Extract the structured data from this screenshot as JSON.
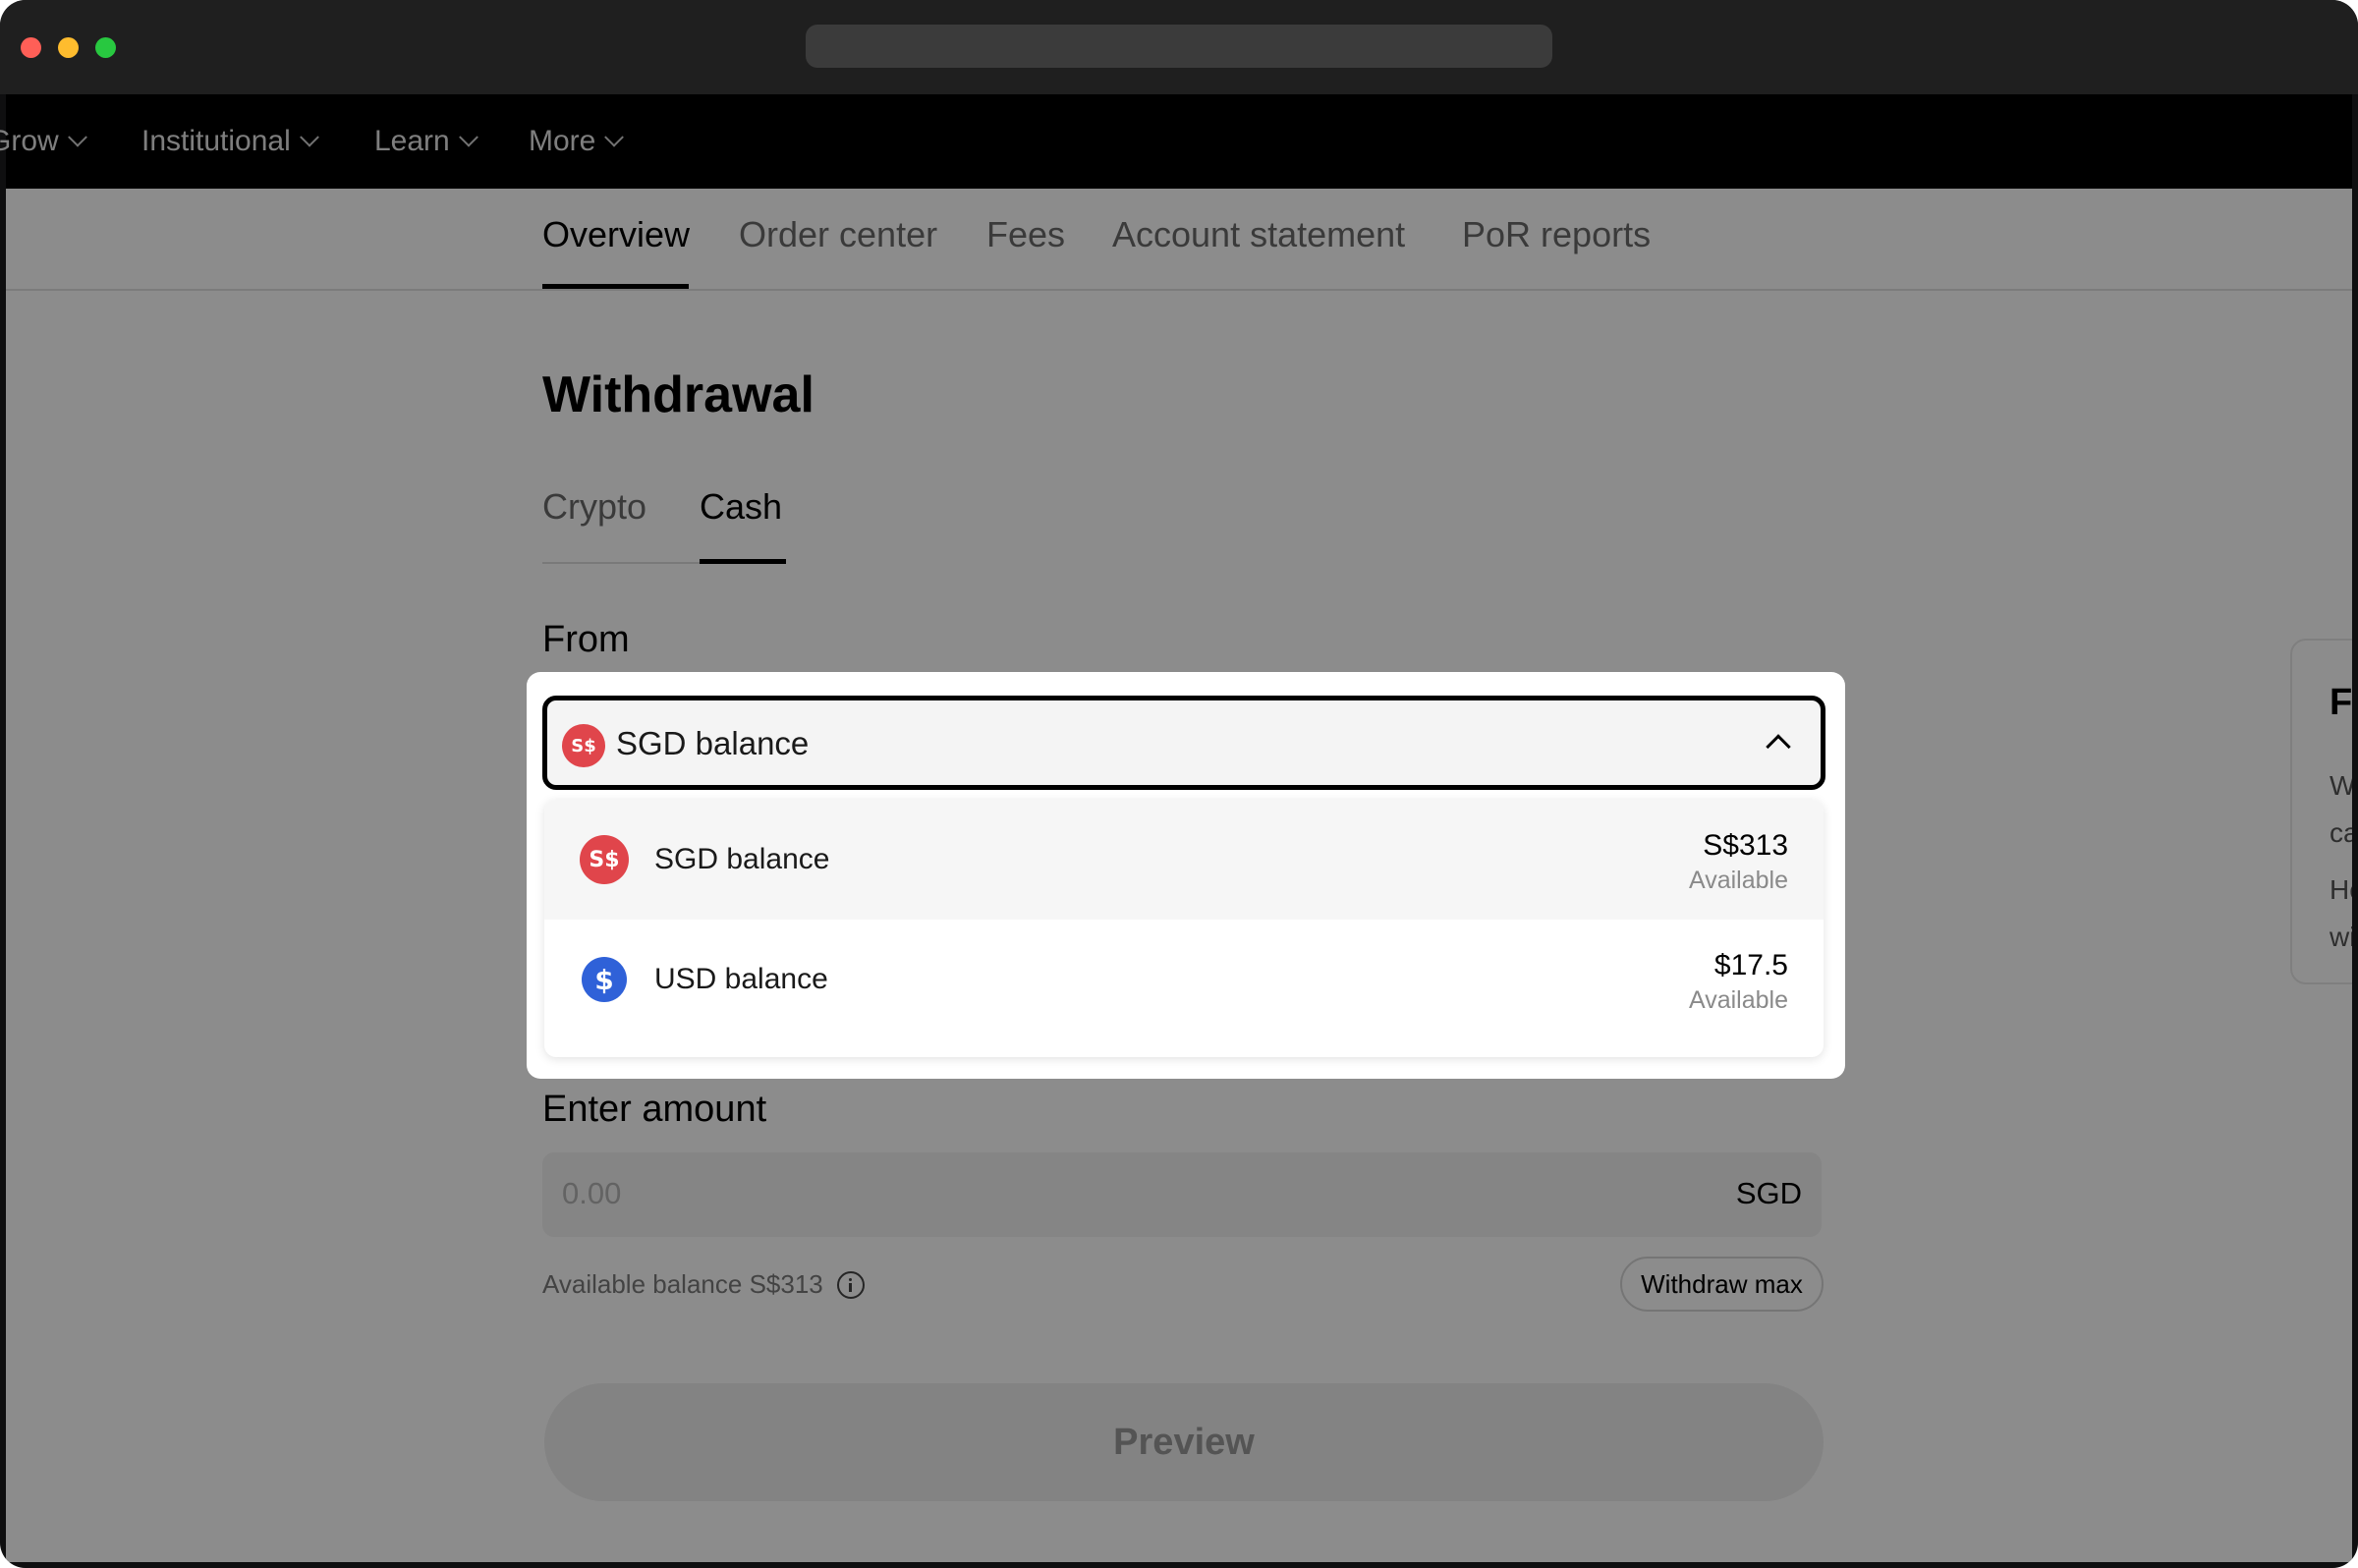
{
  "window": {
    "traffic_lights": [
      "close",
      "minimize",
      "zoom"
    ]
  },
  "topnav": {
    "items": [
      {
        "label": "Grow"
      },
      {
        "label": "Institutional"
      },
      {
        "label": "Learn"
      },
      {
        "label": "More"
      }
    ]
  },
  "subnav": {
    "tabs": [
      {
        "label": "Overview",
        "active": true
      },
      {
        "label": "Order center"
      },
      {
        "label": "Fees"
      },
      {
        "label": "Account statement"
      },
      {
        "label": "PoR reports"
      }
    ]
  },
  "page": {
    "title": "Withdrawal",
    "tabs": [
      {
        "label": "Crypto"
      },
      {
        "label": "Cash",
        "active": true
      }
    ],
    "from_label": "From",
    "amount_label": "Enter amount",
    "amount_placeholder": "0.00",
    "amount_currency": "SGD",
    "available_balance": "Available balance S$313",
    "withdraw_max_label": "Withdraw max",
    "preview_label": "Preview"
  },
  "dropdown": {
    "selected": {
      "label": "SGD balance",
      "icon": "sgd-coin-icon",
      "icon_text": "S$"
    },
    "options": [
      {
        "label": "SGD balance",
        "amount": "S$313",
        "sub": "Available",
        "icon": "sgd-coin-icon",
        "icon_text": "S$",
        "highlighted": true
      },
      {
        "label": "USD balance",
        "amount": "$17.5",
        "sub": "Available",
        "icon": "usd-coin-icon",
        "icon_text": "$"
      }
    ]
  },
  "side_panel": {
    "title": "Fr",
    "line1": "W",
    "line2": "ca",
    "line3": "Ho",
    "line4": "wi"
  },
  "colors": {
    "sgd": "#e0454b",
    "usd": "#2f61d8",
    "overlay": "rgba(0,0,0,0.45)"
  }
}
